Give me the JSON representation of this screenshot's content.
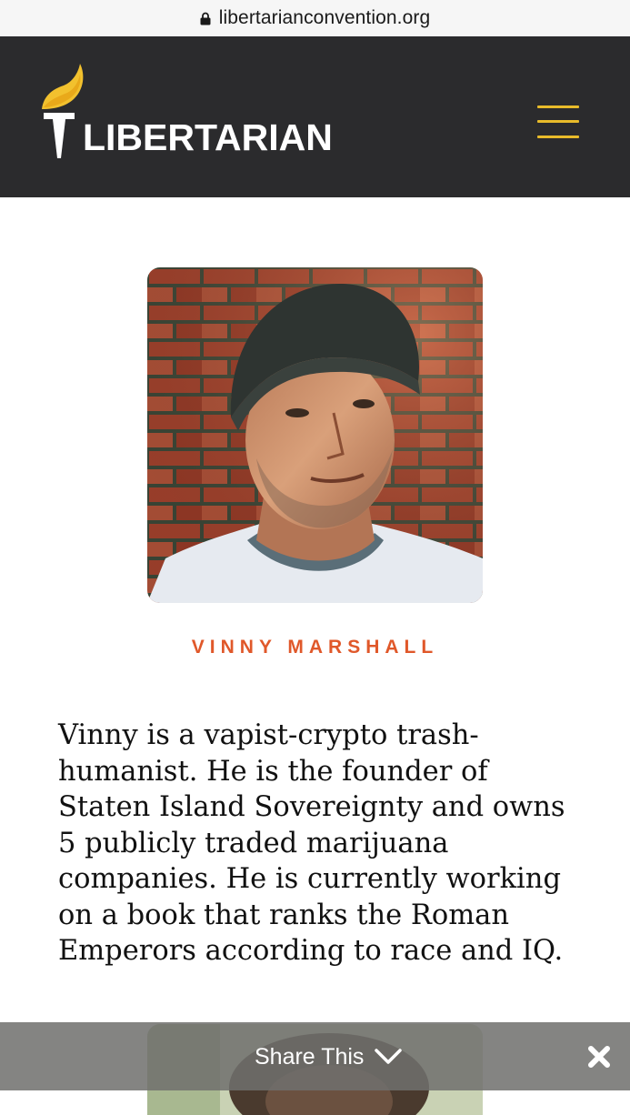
{
  "browser": {
    "url": "libertarianconvention.org",
    "lock_icon": "lock-icon"
  },
  "header": {
    "logo_text": "LIBERTARIAN",
    "logo_icon": "torch-icon",
    "menu_icon": "hamburger-menu-icon",
    "accent_color": "#e8bb2a",
    "background_color": "#2b2b2d"
  },
  "speaker": {
    "name": "VINNY MARSHALL",
    "name_color": "#e0582a",
    "bio": "Vinny is a vapist-crypto trash-humanist. He is the founder of Staten Island Sovereignty and owns 5 publicly traded marijuana companies. He is currently working on a book that ranks the Roman Emperors according to race and IQ."
  },
  "share_bar": {
    "label": "Share This",
    "toggle_icon": "chevron-down-icon",
    "close_icon": "close-icon"
  }
}
